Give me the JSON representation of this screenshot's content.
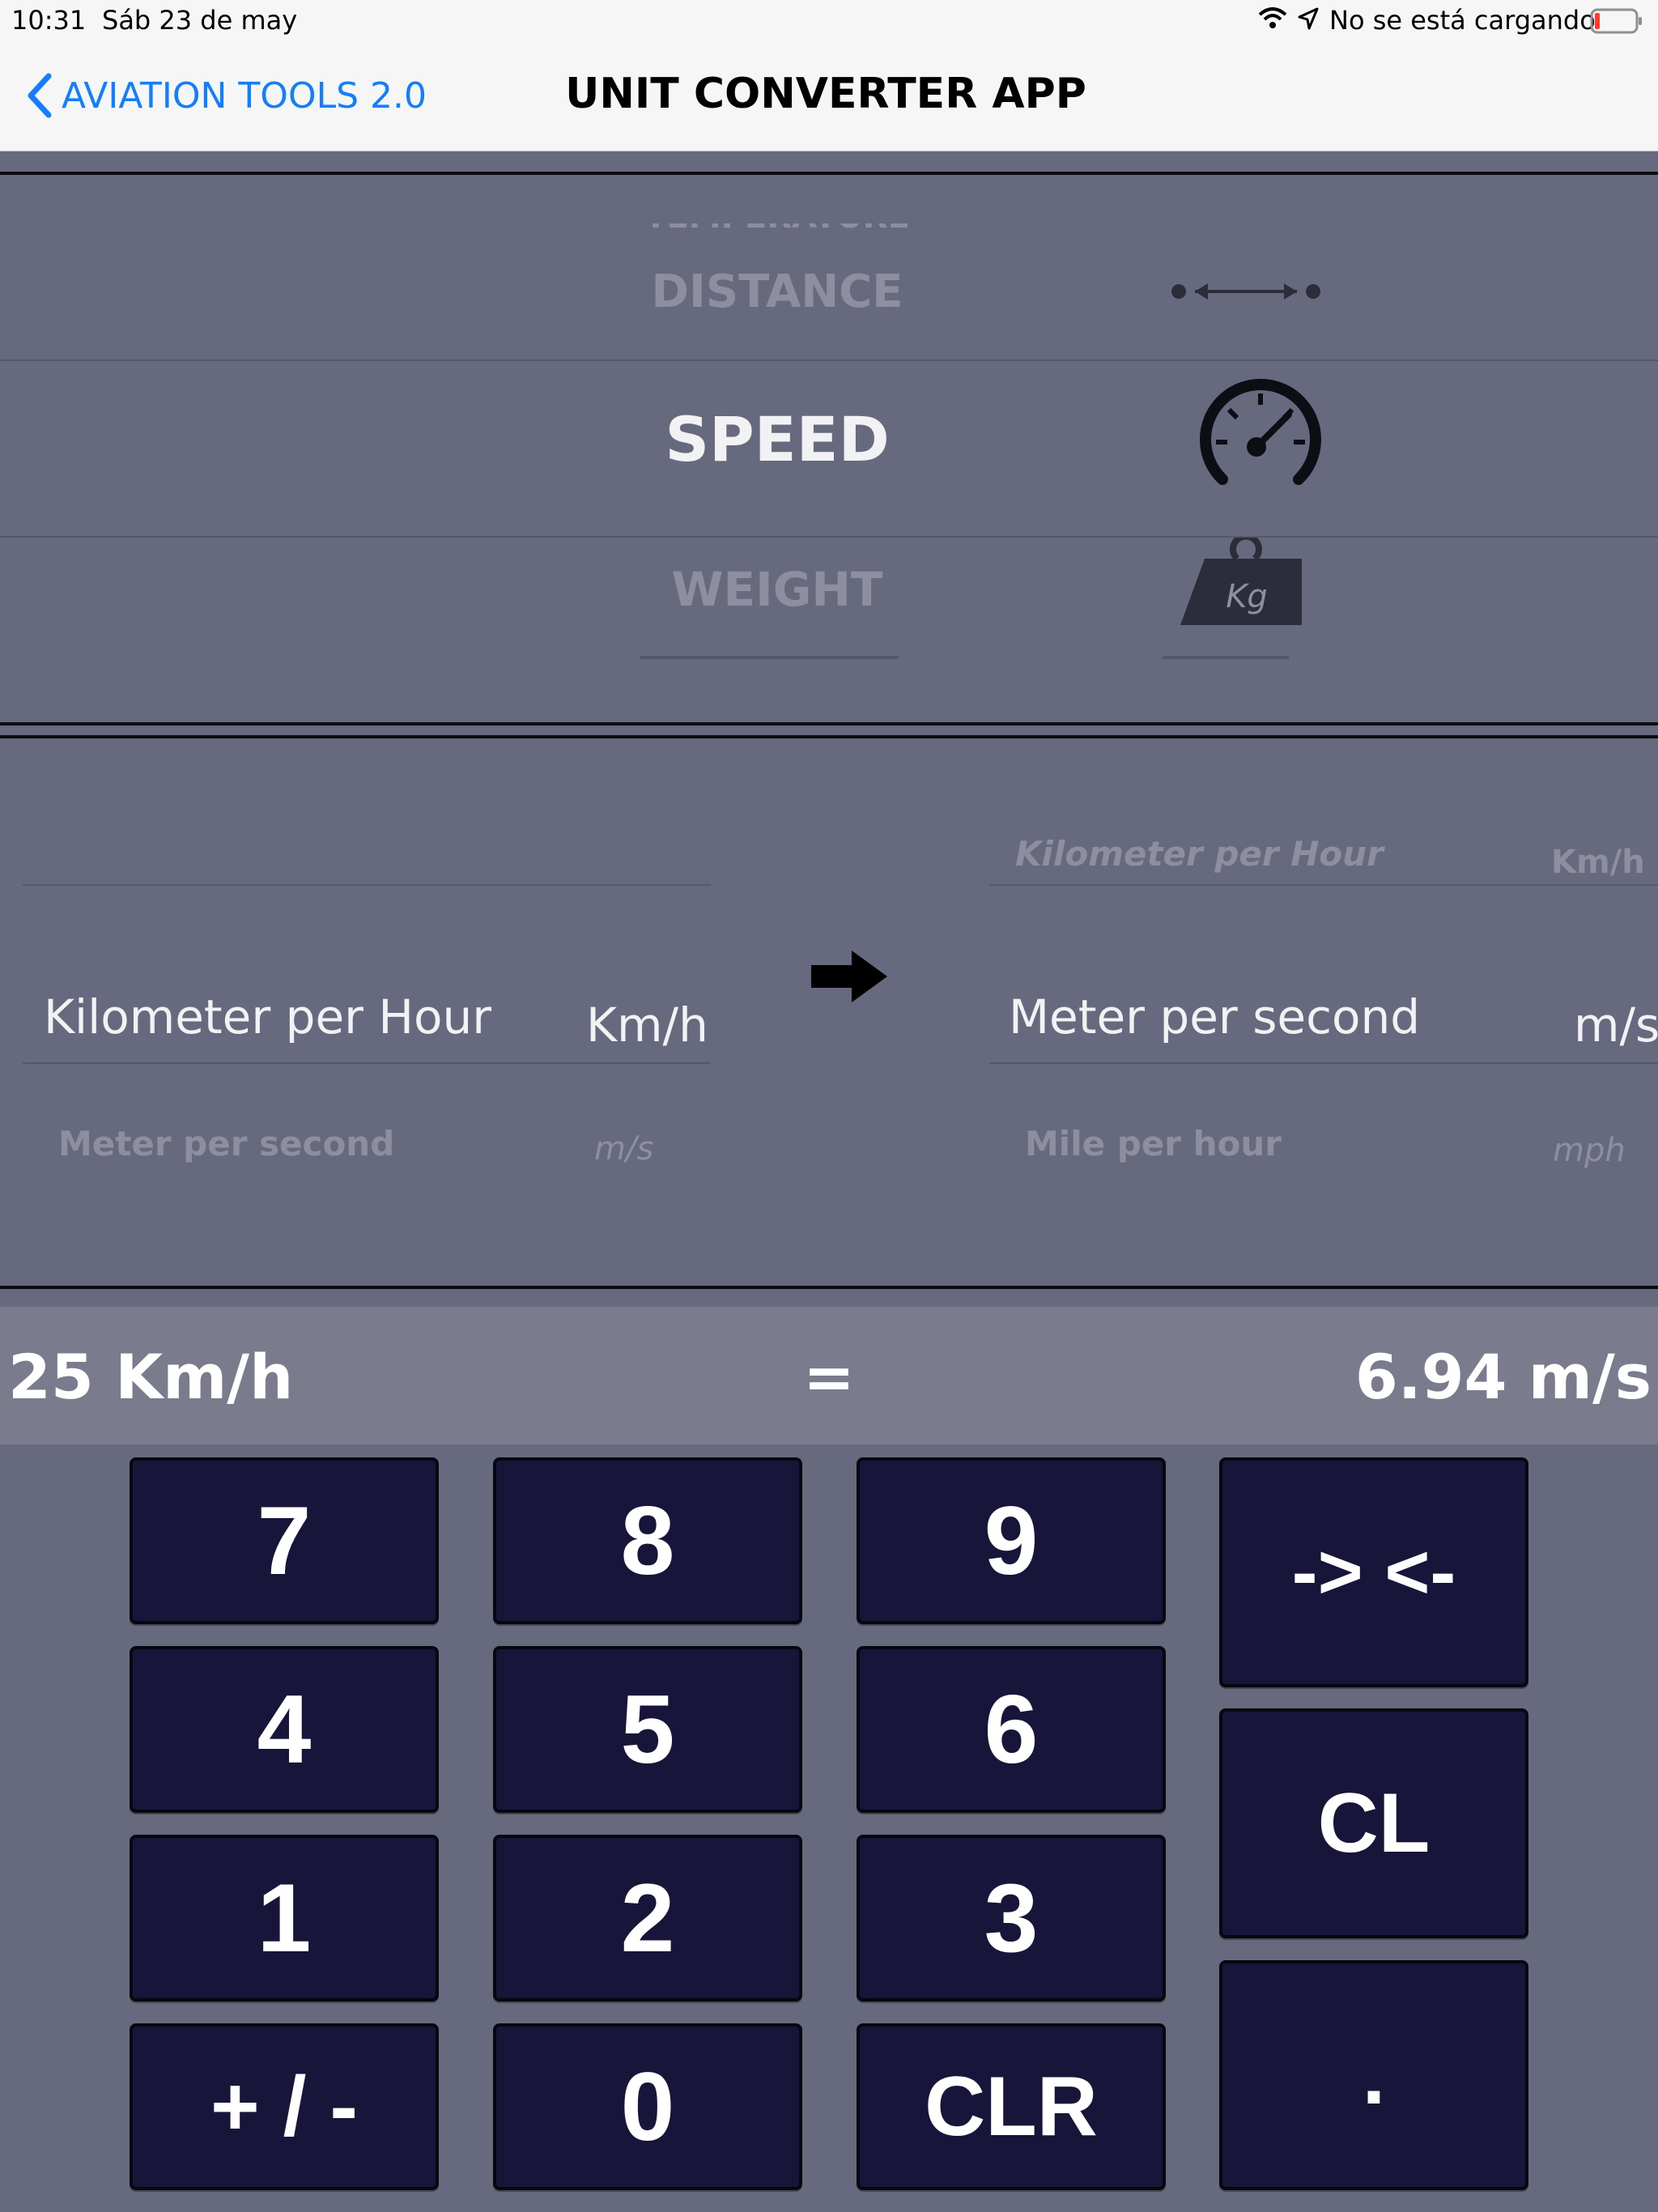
{
  "status_bar": {
    "time": "10:31",
    "date": "Sáb 23 de may",
    "charging_text": "No se está cargando"
  },
  "nav": {
    "back_label": "AVIATION TOOLS 2.0",
    "title": "UNIT CONVERTER APP"
  },
  "category_picker": {
    "faded_above": "TEMPERATURE",
    "items": [
      {
        "label": "DISTANCE",
        "icon": "distance-arrows-icon"
      },
      {
        "label": "SPEED",
        "icon": "speedometer-icon"
      },
      {
        "label": "WEIGHT",
        "icon": "kg-weight-icon"
      }
    ],
    "selected": "SPEED"
  },
  "from_picker": {
    "rows": [
      {
        "name": "Kilometer per Hour",
        "abbr": "Km/h"
      },
      {
        "name": "Meter per second",
        "abbr": "m/s"
      }
    ],
    "selected": "Kilometer per Hour"
  },
  "to_picker": {
    "rows": [
      {
        "name": "Kilometer per Hour",
        "abbr": "Km/h"
      },
      {
        "name": "Meter per second",
        "abbr": "m/s"
      },
      {
        "name": "Mile per hour",
        "abbr": "mph"
      }
    ],
    "selected": "Meter per second"
  },
  "result": {
    "input": "25 Km/h",
    "equals": "=",
    "output": "6.94 m/s"
  },
  "keypad": {
    "keys": [
      "7",
      "8",
      "9",
      "4",
      "5",
      "6",
      "1",
      "2",
      "3",
      "+ / -",
      "0",
      "CLR"
    ],
    "side_keys": [
      "-> <-",
      "CL",
      "."
    ]
  },
  "colors": {
    "background": "#676a7e",
    "key_fill": "#17163a",
    "link_blue": "#147efb",
    "result_bar": "#7a7b8c"
  }
}
